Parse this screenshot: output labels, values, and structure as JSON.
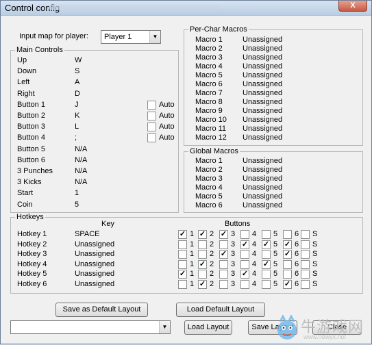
{
  "window": {
    "title": "Control config",
    "close_label": "X"
  },
  "input_map": {
    "label": "Input map for player:",
    "selected": "Player 1"
  },
  "main_controls": {
    "legend": "Main Controls",
    "auto_label": "Auto",
    "rows": [
      {
        "name": "Up",
        "value": "W"
      },
      {
        "name": "Down",
        "value": "S"
      },
      {
        "name": "Left",
        "value": "A"
      },
      {
        "name": "Right",
        "value": "D"
      },
      {
        "name": "Button 1",
        "value": "J"
      },
      {
        "name": "Button 2",
        "value": "K"
      },
      {
        "name": "Button 3",
        "value": "L"
      },
      {
        "name": "Button 4",
        "value": ";"
      },
      {
        "name": "Button 5",
        "value": "N/A"
      },
      {
        "name": "Button 6",
        "value": "N/A"
      },
      {
        "name": "3 Punches",
        "value": "N/A"
      },
      {
        "name": "3 Kicks",
        "value": "N/A"
      },
      {
        "name": "Start",
        "value": "1"
      },
      {
        "name": "Coin",
        "value": "5"
      }
    ]
  },
  "per_char_macros": {
    "legend": "Per-Char Macros",
    "rows": [
      {
        "name": "Macro 1",
        "value": "Unassigned"
      },
      {
        "name": "Macro 2",
        "value": "Unassigned"
      },
      {
        "name": "Macro 3",
        "value": "Unassigned"
      },
      {
        "name": "Macro 4",
        "value": "Unassigned"
      },
      {
        "name": "Macro 5",
        "value": "Unassigned"
      },
      {
        "name": "Macro 6",
        "value": "Unassigned"
      },
      {
        "name": "Macro 7",
        "value": "Unassigned"
      },
      {
        "name": "Macro 8",
        "value": "Unassigned"
      },
      {
        "name": "Macro 9",
        "value": "Unassigned"
      },
      {
        "name": "Macro 10",
        "value": "Unassigned"
      },
      {
        "name": "Macro 11",
        "value": "Unassigned"
      },
      {
        "name": "Macro 12",
        "value": "Unassigned"
      }
    ]
  },
  "global_macros": {
    "legend": "Global Macros",
    "rows": [
      {
        "name": "Macro 1",
        "value": "Unassigned"
      },
      {
        "name": "Macro 2",
        "value": "Unassigned"
      },
      {
        "name": "Macro 3",
        "value": "Unassigned"
      },
      {
        "name": "Macro 4",
        "value": "Unassigned"
      },
      {
        "name": "Macro 5",
        "value": "Unassigned"
      },
      {
        "name": "Macro 6",
        "value": "Unassigned"
      }
    ]
  },
  "hotkeys": {
    "legend": "Hotkeys",
    "key_header": "Key",
    "buttons_header": "Buttons",
    "button_labels": [
      "1",
      "2",
      "3",
      "4",
      "5",
      "6",
      "S"
    ],
    "rows": [
      {
        "name": "Hotkey 1",
        "key": "SPACE",
        "checks": [
          true,
          true,
          true,
          false,
          false,
          false,
          false
        ]
      },
      {
        "name": "Hotkey 2",
        "key": "Unassigned",
        "checks": [
          false,
          false,
          false,
          true,
          true,
          true,
          false
        ]
      },
      {
        "name": "Hotkey 3",
        "key": "Unassigned",
        "checks": [
          false,
          false,
          true,
          false,
          false,
          true,
          false
        ]
      },
      {
        "name": "Hotkey 4",
        "key": "Unassigned",
        "checks": [
          false,
          true,
          false,
          false,
          true,
          false,
          false
        ]
      },
      {
        "name": "Hotkey 5",
        "key": "Unassigned",
        "checks": [
          true,
          false,
          false,
          true,
          false,
          false,
          false
        ]
      },
      {
        "name": "Hotkey 6",
        "key": "Unassigned",
        "checks": [
          false,
          true,
          false,
          false,
          false,
          true,
          false
        ]
      }
    ]
  },
  "buttons": {
    "save_default": "Save as  Default Layout",
    "load_default": "Load Default Layout",
    "load_layout": "Load Layout",
    "save_layout": "Save Layout",
    "close": "Close"
  },
  "layout_combo": {
    "value": ""
  },
  "watermark": {
    "text": "牛游戏网",
    "url": "www.newyx.net"
  }
}
